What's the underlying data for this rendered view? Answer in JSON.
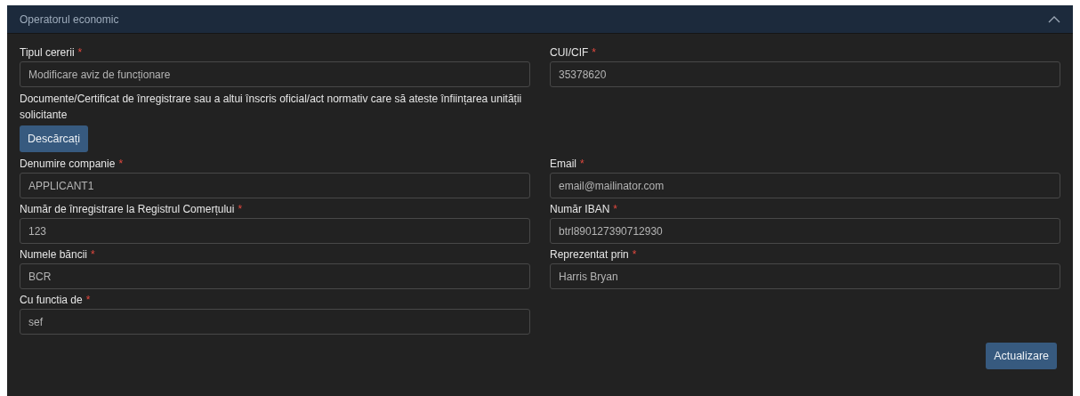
{
  "panel": {
    "title": "Operatorul economic",
    "expanded": true
  },
  "rows": [
    {
      "cells": [
        {
          "kind": "input",
          "label": "Tipul cererii",
          "mark": "*",
          "value": "Modificare aviz de funcționare"
        },
        {
          "kind": "input",
          "label": "CUI/CIF",
          "mark": "*",
          "value": "35378620"
        }
      ]
    },
    {
      "cells": [
        {
          "kind": "document",
          "text": "Documente/Certificat de înregistrare sau a altui înscris oficial/act normativ care să ateste înființarea unității solicitante",
          "button": "Descărcați"
        }
      ]
    },
    {
      "cells": [
        {
          "kind": "input",
          "label": "Denumire companie",
          "mark": "*",
          "value": "APPLICANT1"
        },
        {
          "kind": "input",
          "label": "Email",
          "mark": "*",
          "value": "email@mailinator.com"
        }
      ]
    },
    {
      "cells": [
        {
          "kind": "input",
          "label": "Număr de înregistrare la Registrul Comerțului",
          "mark": "*",
          "value": "123"
        },
        {
          "kind": "input",
          "label": "Număr IBAN",
          "mark": "*",
          "value": "btrl890127390712930"
        }
      ]
    },
    {
      "cells": [
        {
          "kind": "input",
          "label": "Numele băncii",
          "mark": "*",
          "value": "BCR"
        },
        {
          "kind": "input",
          "label": "Reprezentat prin",
          "mark": "*",
          "value": "Harris Bryan"
        }
      ]
    },
    {
      "cells": [
        {
          "kind": "input",
          "label": "Cu functia de",
          "mark": "*",
          "value": "sef"
        }
      ]
    }
  ],
  "submit": "Actualizare"
}
